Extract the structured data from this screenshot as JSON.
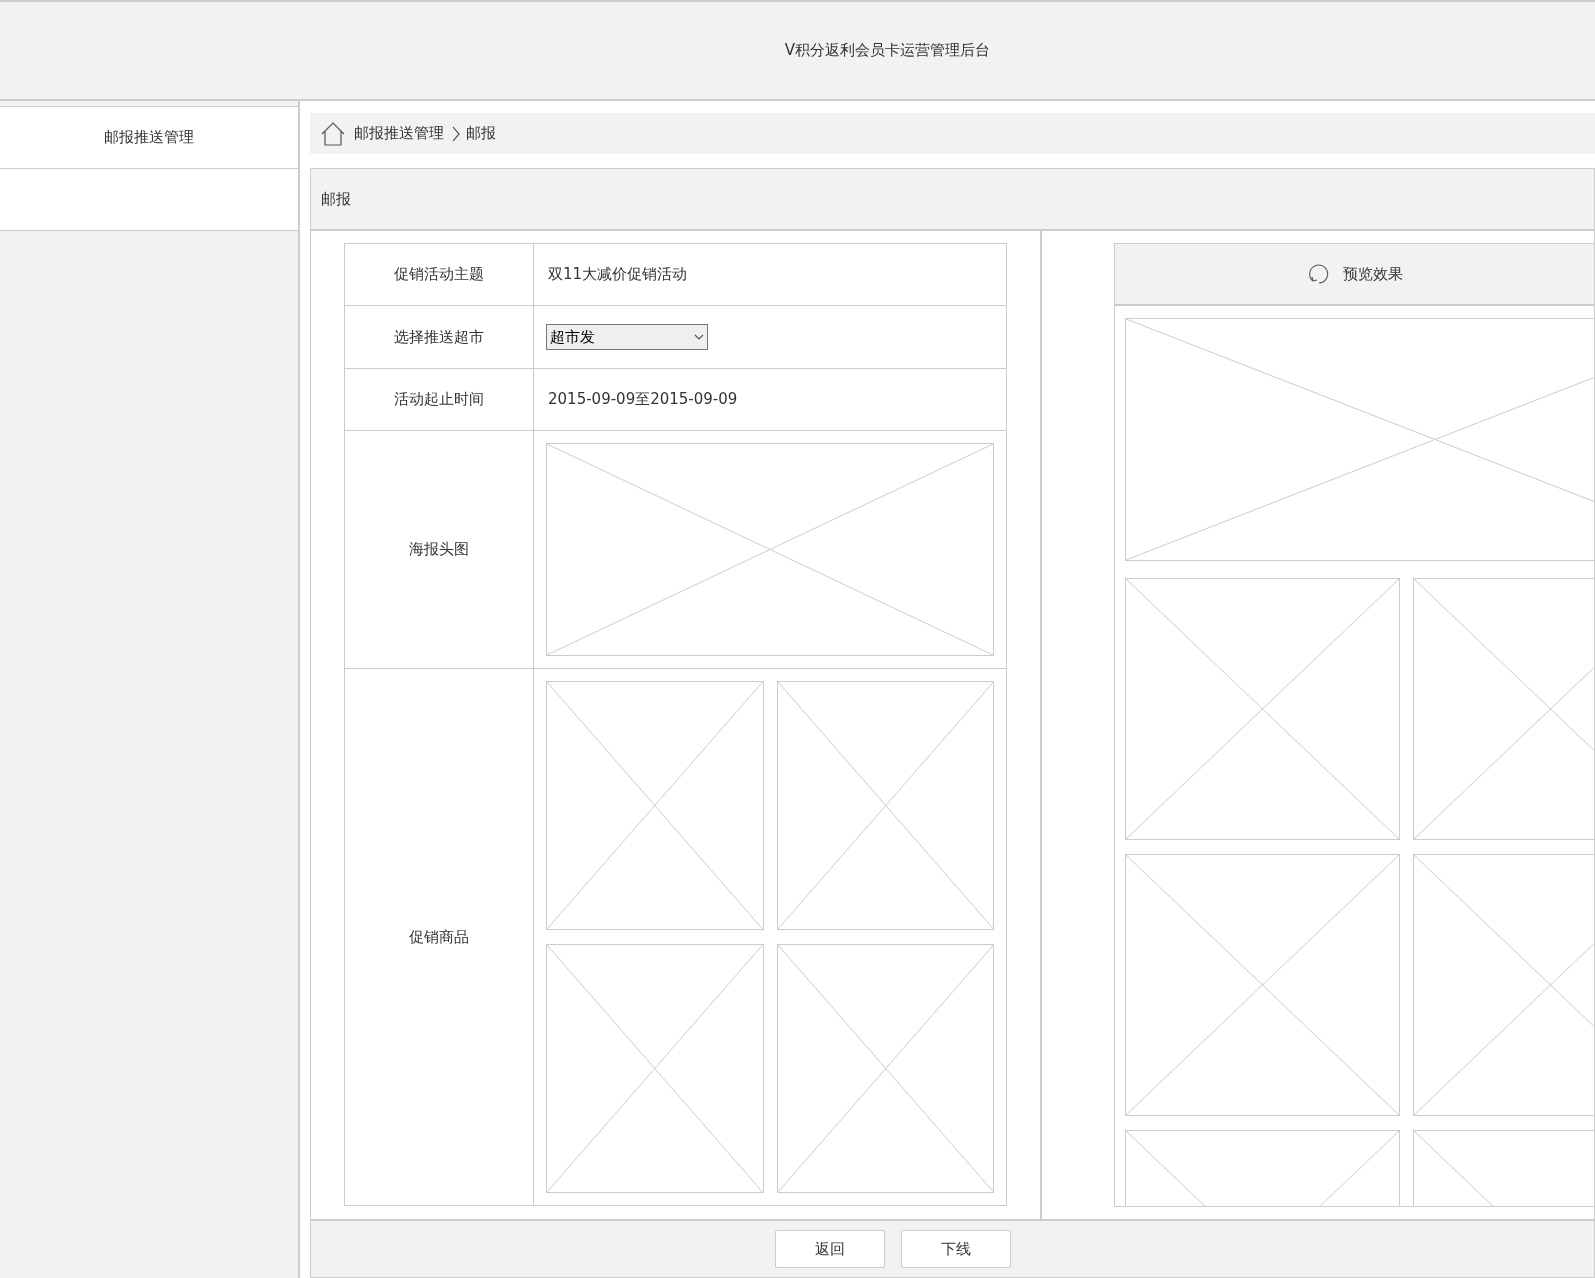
{
  "header": {
    "title": "V积分返利会员卡运营管理后台"
  },
  "sidebar": {
    "items": [
      {
        "label": "邮报推送管理"
      }
    ]
  },
  "breadcrumb": [
    "邮报推送管理",
    "邮报"
  ],
  "panel": {
    "title": "邮报",
    "form": [
      {
        "kind": "text",
        "label": "促销活动主题",
        "value": "双11大减价促销活动"
      },
      {
        "kind": "select",
        "label": "选择推送超市",
        "value": "超市发"
      },
      {
        "kind": "text",
        "label": "活动起止时间",
        "value": "2015-09-09至2015-09-09"
      },
      {
        "kind": "image",
        "label": "海报头图"
      },
      {
        "kind": "image_grid",
        "label": "促销商品"
      }
    ],
    "preview": {
      "title": "预览效果"
    },
    "buttons": [
      "返回",
      "下线"
    ]
  }
}
